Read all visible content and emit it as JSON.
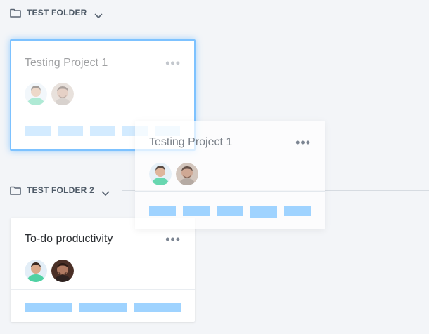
{
  "folders": [
    {
      "name": "TEST FOLDER"
    },
    {
      "name": "TEST FOLDER 2"
    }
  ],
  "projects": [
    {
      "title": "Testing Project 1",
      "menu": "•••"
    },
    {
      "title": "Testing Project 1",
      "menu": "•••"
    },
    {
      "title": "To-do productivity",
      "menu": "•••"
    }
  ],
  "icons": {
    "folder": "folder-icon",
    "chevron": "chevron-down-icon",
    "more": "more-options-icon",
    "avatar": "avatar"
  },
  "colors": {
    "accent": "#7dc2ff",
    "tag": "#9fd3ff",
    "background": "#f3f5f8"
  }
}
